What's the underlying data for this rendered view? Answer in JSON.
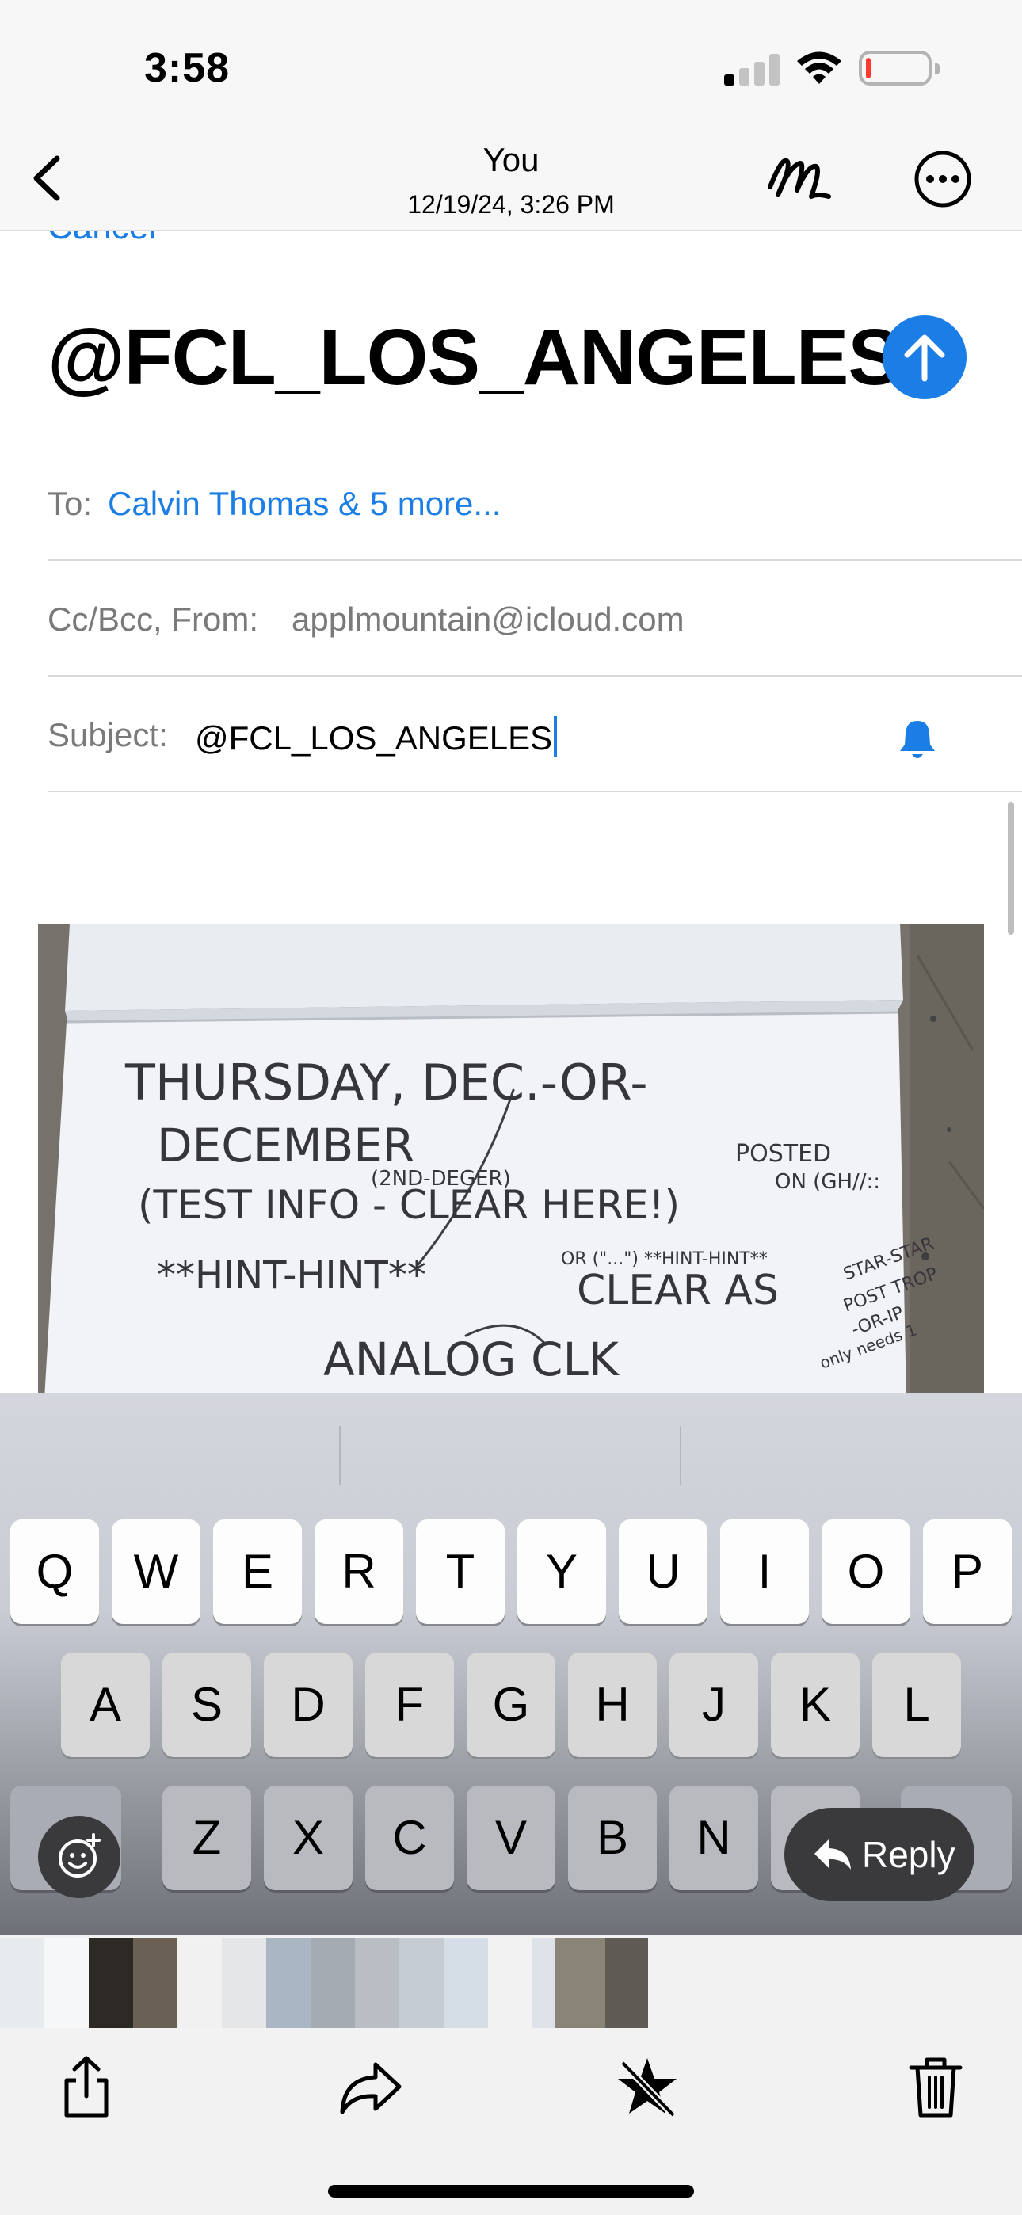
{
  "status_bar": {
    "time": "3:58",
    "signal_bars_active": 1,
    "battery_level_percent": 5
  },
  "viewer_header": {
    "title": "You",
    "subtitle": "12/19/24, 3:26 PM",
    "icons": [
      "back-icon",
      "markup-icon",
      "more-icon"
    ]
  },
  "compose": {
    "cancel_label": "Cancel",
    "title": "@FCL_LOS_ANGELES",
    "to_label": "To:",
    "to_value": "Calvin Thomas & 5 more...",
    "cc_label": "Cc/Bcc, From:",
    "cc_value": "applmountain@icloud.com",
    "subject_label": "Subject:",
    "subject_value": "@FCL_LOS_ANGELES",
    "accent_color": "#1a7ee6"
  },
  "note_photo": {
    "lines": [
      "THURSDAY, DEC.-OR-",
      "DECEMBER",
      "(2ND-DEGER)",
      "POSTED",
      "ON (GH//::",
      "(TEST INFO - CLEAR HERE!)",
      "**HINT-HINT**",
      "OR (\"...\") **HINT-HINT**",
      "CLEAR AS",
      "STAR-STAR",
      "POST TROP",
      "-OR-IP",
      "only needs 1",
      "ANALOG CLK"
    ]
  },
  "keyboard": {
    "row1": [
      "Q",
      "W",
      "E",
      "R",
      "T",
      "Y",
      "U",
      "I",
      "O",
      "P"
    ],
    "row2": [
      "A",
      "S",
      "D",
      "F",
      "G",
      "H",
      "J",
      "K",
      "L"
    ],
    "row3": [
      "Z",
      "X",
      "C",
      "V",
      "B",
      "N"
    ],
    "reply_label": "Reply"
  },
  "toolbar": {
    "icons": [
      "share-icon",
      "forward-icon",
      "unfavorite-star-icon",
      "trash-icon"
    ]
  }
}
